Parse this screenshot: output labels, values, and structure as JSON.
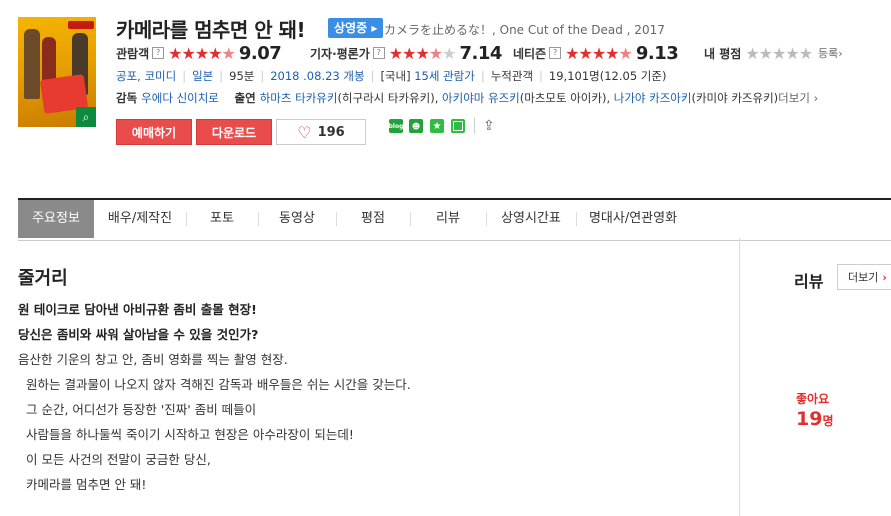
{
  "movie": {
    "title": "카메라를 멈추면 안 돼!",
    "status_badge": "상영중",
    "original_title": "カメラを止めるな！, One Cut of the Dead , 2017"
  },
  "ratings": {
    "audience_label": "관람객",
    "audience_score": "9.07",
    "critic_label": "기자·평론가",
    "critic_score": "7.14",
    "netizen_label": "네티즌",
    "netizen_score": "9.13",
    "my_label": "내 평점",
    "register_label": "등록›",
    "help_icon": "?"
  },
  "info": {
    "genre": "공포, 코미디",
    "country": "일본",
    "runtime": "95분",
    "release": "2018 .08.23 개봉",
    "rating_prefix": "[국내]",
    "rating": "15세 관람가",
    "attendance_label": "누적관객",
    "attendance_value": "19,101명(12.05 기준)"
  },
  "credits": {
    "director_label": "감독",
    "director": "우에다 신이치로",
    "cast_label": "출연",
    "cast1": "하마츠 타카유키",
    "cast1_note": "(히구라시 타카유키),",
    "cast2": "아키야마 유즈키",
    "cast2_note": "(마츠모토 아이카),",
    "cast3": "나가야 카즈아키",
    "cast3_note": "(카미야 카즈유키)",
    "more": "더보기 ›"
  },
  "buttons": {
    "reserve": "예매하기",
    "download": "다운로드",
    "like_count": "196",
    "blog": "blog"
  },
  "tabs": [
    "주요정보",
    "배우/제작진",
    "포토",
    "동영상",
    "평점",
    "리뷰",
    "상영시간표",
    "명대사/연관영화"
  ],
  "summary": {
    "heading": "줄거리",
    "lead1": "원 테이크로 담아낸 아비규환 좀비 출몰 현장!",
    "lead2": "당신은 좀비와 싸워 살아남을 수 있을 것인가?",
    "lines": [
      "음산한 기운의 창고 안, 좀비 영화를 찍는 촬영 현장.",
      "원하는 결과물이 나오지 않자 격해진 감독과 배우들은 쉬는 시간을 갖는다.",
      "그 순간, 어디선가 등장한 '진짜' 좀비 떼들이",
      "사람들을 하나둘씩 죽이기 시작하고 현장은 아수라장이 되는데!",
      "이 모든 사건의 전말이 궁금한 당신,",
      "카메라를 멈추면 안 돼!"
    ]
  },
  "review": {
    "heading": "리뷰",
    "more": "더보기",
    "like_label": "좋아요",
    "like_count": "19",
    "like_unit": "명"
  }
}
